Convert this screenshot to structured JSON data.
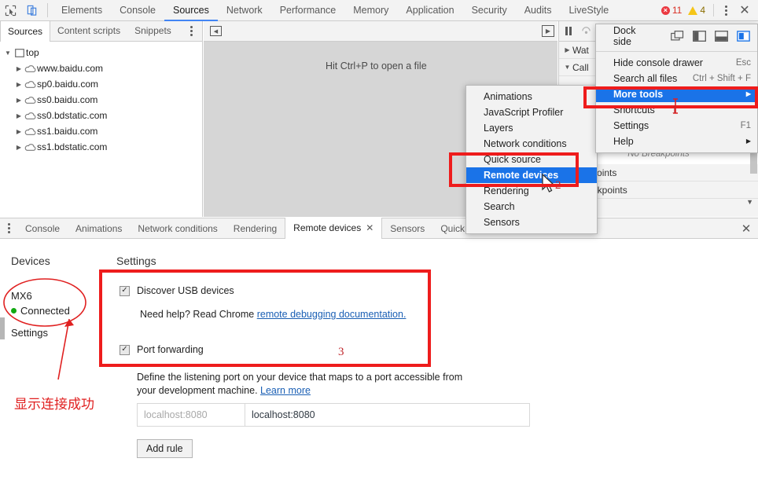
{
  "toolbar": {
    "icons": [
      {
        "name": "inspect-element-icon"
      },
      {
        "name": "device-toolbar-icon"
      }
    ],
    "tabs": [
      {
        "label": "Elements",
        "active": false
      },
      {
        "label": "Console",
        "active": false
      },
      {
        "label": "Sources",
        "active": true
      },
      {
        "label": "Network",
        "active": false
      },
      {
        "label": "Performance",
        "active": false
      },
      {
        "label": "Memory",
        "active": false
      },
      {
        "label": "Application",
        "active": false
      },
      {
        "label": "Security",
        "active": false
      },
      {
        "label": "Audits",
        "active": false
      },
      {
        "label": "LiveStyle",
        "active": false
      }
    ],
    "error_count": "11",
    "warning_count": "4",
    "error_color": "#eb3941",
    "warning_color": "#f5c518",
    "menu_icon": "kebab-menu-icon",
    "close_icon": "✕"
  },
  "sources_subtabs": {
    "tabs": [
      {
        "label": "Sources",
        "active": true
      },
      {
        "label": "Content scripts",
        "active": false
      },
      {
        "label": "Snippets",
        "active": false
      }
    ]
  },
  "navigator": {
    "root": {
      "label": "top",
      "twisty": "▼",
      "icon": "frame-icon"
    },
    "items": [
      {
        "label": "www.baidu.com",
        "twisty": "▶",
        "icon": "cloud-icon"
      },
      {
        "label": "sp0.baidu.com",
        "twisty": "▶",
        "icon": "cloud-icon"
      },
      {
        "label": "ss0.baidu.com",
        "twisty": "▶",
        "icon": "cloud-icon"
      },
      {
        "label": "ss0.bdstatic.com",
        "twisty": "▶",
        "icon": "cloud-icon"
      },
      {
        "label": "ss1.baidu.com",
        "twisty": "▶",
        "icon": "cloud-icon"
      },
      {
        "label": "ss1.bdstatic.com",
        "twisty": "▶",
        "icon": "cloud-icon"
      }
    ]
  },
  "editor": {
    "hint": "Hit Ctrl+P to open a file",
    "left_toggle_icon": "show-navigator-icon",
    "right_toggle_icon": "show-debugger-icon"
  },
  "debugger": {
    "pause_icon": "pause-script-icon",
    "sections": [
      {
        "label": "Wat",
        "twisty": "▶"
      },
      {
        "label": "Call",
        "twisty": "▼"
      }
    ],
    "empty_text": "No Breakpoints",
    "lists": [
      "Breakpoints",
      "M Breakpoints"
    ],
    "more_icon": "chevron-down-icon"
  },
  "drawer": {
    "menu_icon": "kebab-menu-icon",
    "tabs": [
      {
        "label": "Console",
        "active": false,
        "closable": false
      },
      {
        "label": "Animations",
        "active": false,
        "closable": false
      },
      {
        "label": "Network conditions",
        "active": false,
        "closable": false
      },
      {
        "label": "Rendering",
        "active": false,
        "closable": false
      },
      {
        "label": "Remote devices",
        "active": true,
        "closable": true
      },
      {
        "label": "Sensors",
        "active": false,
        "closable": false
      },
      {
        "label": "Quick s",
        "active": false,
        "closable": false
      }
    ],
    "close_label": "✕"
  },
  "remote_devices": {
    "devices_title": "Devices",
    "device_name": "MX6",
    "device_status": "Connected",
    "status_color": "#11a911",
    "settings_nav_label": "Settings",
    "settings_title": "Settings",
    "discover_usb": {
      "label": "Discover USB devices",
      "checked": true,
      "help_prefix": "Need help? Read Chrome ",
      "help_link": "remote debugging documentation."
    },
    "port_forwarding": {
      "label": "Port forwarding",
      "checked": true,
      "description": "Define the listening port on your device that maps to a port accessible from your development machine. ",
      "description_link": "Learn more",
      "rule_placeholder": "localhost:8080",
      "rule_value": "localhost:8080",
      "add_rule_label": "Add rule"
    }
  },
  "more_tools_submenu": {
    "items": [
      {
        "label": "Animations",
        "selected": false
      },
      {
        "label": "JavaScript Profiler",
        "selected": false
      },
      {
        "label": "Layers",
        "selected": false
      },
      {
        "label": "Network conditions",
        "selected": false
      },
      {
        "label": "Quick source",
        "selected": false
      },
      {
        "label": "Remote devices",
        "selected": true
      },
      {
        "label": "Rendering",
        "selected": false
      },
      {
        "label": "Search",
        "selected": false
      },
      {
        "label": "Sensors",
        "selected": false
      }
    ]
  },
  "main_menu": {
    "dock_side_label": "Dock side",
    "dock_options": [
      {
        "name": "dock-undocked-icon",
        "active": false
      },
      {
        "name": "dock-left-icon",
        "active": false
      },
      {
        "name": "dock-bottom-icon",
        "active": false
      },
      {
        "name": "dock-right-icon",
        "active": true
      }
    ],
    "active_dock_color": "#1a73e8",
    "items": [
      {
        "label": "Hide console drawer",
        "shortcut": "Esc",
        "selected": false,
        "submenu": false
      },
      {
        "label": "Search all files",
        "shortcut": "Ctrl + Shift + F",
        "selected": false,
        "submenu": false
      },
      {
        "label": "More tools",
        "shortcut": "",
        "selected": true,
        "submenu": true
      },
      {
        "label": "Shortcuts",
        "shortcut": "",
        "selected": false,
        "submenu": false
      },
      {
        "label": "Settings",
        "shortcut": "F1",
        "selected": false,
        "submenu": false
      },
      {
        "label": "Help",
        "shortcut": "",
        "selected": false,
        "submenu": true
      }
    ]
  },
  "annotations": {
    "highlight_color": "#ee1c1c",
    "number_1": "1",
    "number_2": "2",
    "number_3": "3",
    "chinese_note": "显示连接成功"
  }
}
